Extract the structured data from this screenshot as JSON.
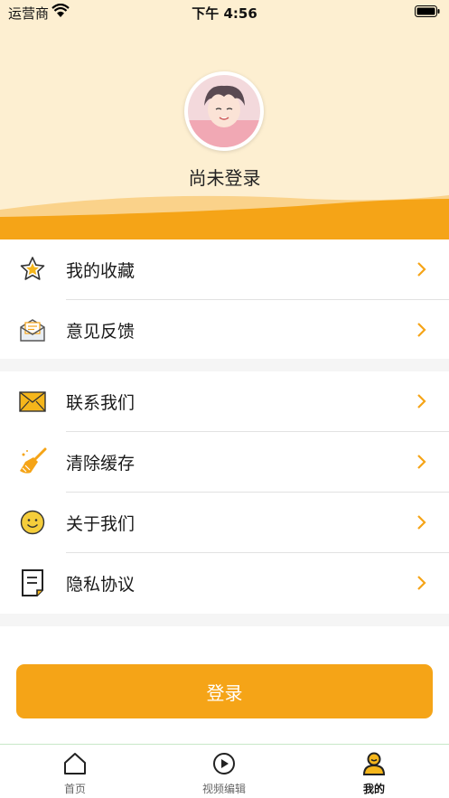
{
  "status_bar": {
    "carrier": "运营商",
    "time": "下午 4:56"
  },
  "profile": {
    "username": "尚未登录"
  },
  "menu_group_1": [
    {
      "label": "我的收藏",
      "icon": "star-icon"
    },
    {
      "label": "意见反馈",
      "icon": "mail-open-icon"
    }
  ],
  "menu_group_2": [
    {
      "label": "联系我们",
      "icon": "envelope-icon"
    },
    {
      "label": "清除缓存",
      "icon": "broom-icon"
    },
    {
      "label": "关于我们",
      "icon": "smiley-icon"
    },
    {
      "label": "隐私协议",
      "icon": "document-icon"
    }
  ],
  "login_button": "登录",
  "tabbar": [
    {
      "label": "首页",
      "icon": "home-icon",
      "active": false
    },
    {
      "label": "视频编辑",
      "icon": "play-circle-icon",
      "active": false
    },
    {
      "label": "我的",
      "icon": "user-icon",
      "active": true
    }
  ],
  "colors": {
    "accent": "#f5a417",
    "header_bg": "#fdefd1"
  }
}
